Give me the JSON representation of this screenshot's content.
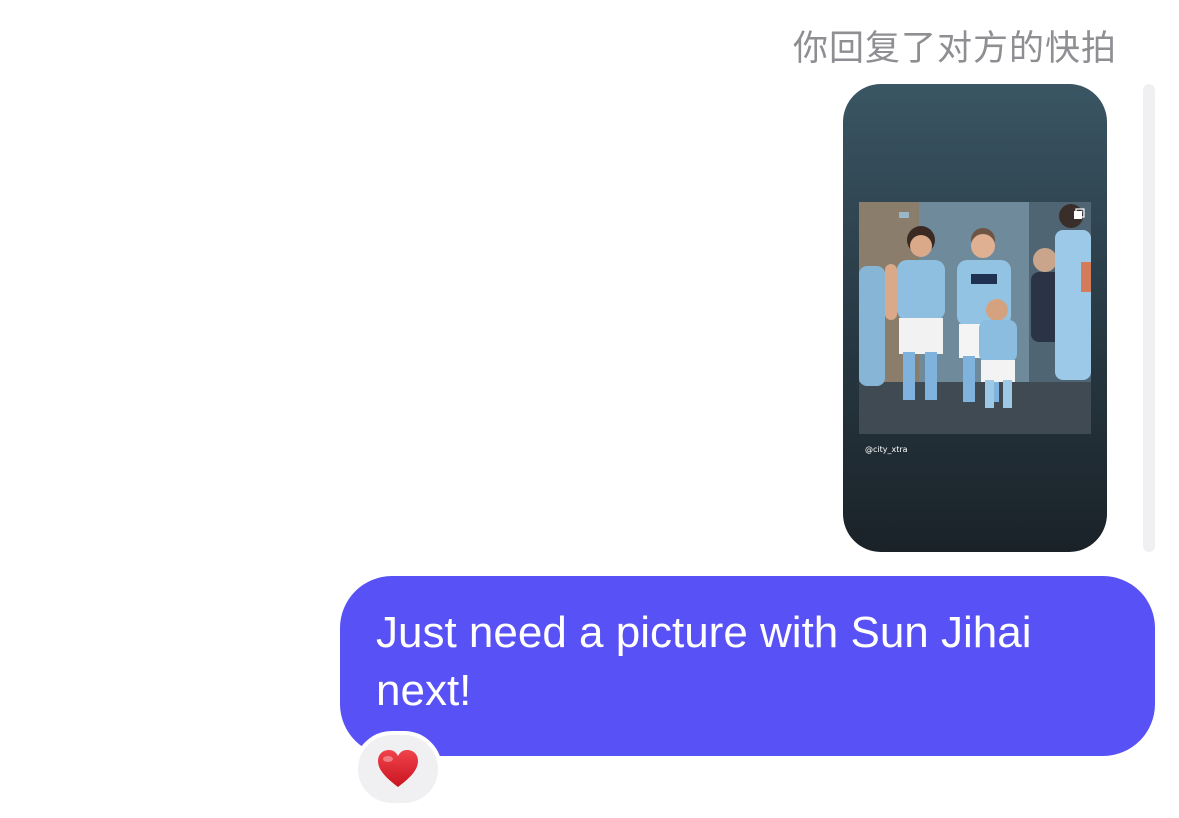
{
  "thread": {
    "reply_caption": "你回复了对方的快拍",
    "story": {
      "watermark": "@city_xtra"
    },
    "message": {
      "text": "Just need a picture with Sun Jihai next!",
      "bubble_color": "#5851f6"
    },
    "reaction": {
      "emoji_name": "red-heart-icon",
      "color": "#e0202e"
    }
  }
}
